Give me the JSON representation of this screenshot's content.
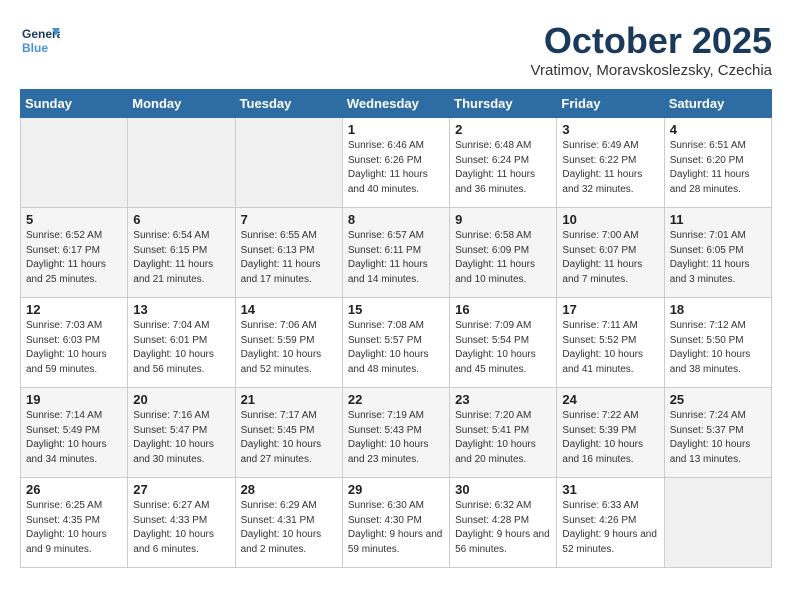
{
  "header": {
    "logo_line1": "General",
    "logo_line2": "Blue",
    "month": "October 2025",
    "location": "Vratimov, Moravskoslezsky, Czechia"
  },
  "weekdays": [
    "Sunday",
    "Monday",
    "Tuesday",
    "Wednesday",
    "Thursday",
    "Friday",
    "Saturday"
  ],
  "weeks": [
    [
      {
        "day": "",
        "info": ""
      },
      {
        "day": "",
        "info": ""
      },
      {
        "day": "",
        "info": ""
      },
      {
        "day": "1",
        "info": "Sunrise: 6:46 AM\nSunset: 6:26 PM\nDaylight: 11 hours\nand 40 minutes."
      },
      {
        "day": "2",
        "info": "Sunrise: 6:48 AM\nSunset: 6:24 PM\nDaylight: 11 hours\nand 36 minutes."
      },
      {
        "day": "3",
        "info": "Sunrise: 6:49 AM\nSunset: 6:22 PM\nDaylight: 11 hours\nand 32 minutes."
      },
      {
        "day": "4",
        "info": "Sunrise: 6:51 AM\nSunset: 6:20 PM\nDaylight: 11 hours\nand 28 minutes."
      }
    ],
    [
      {
        "day": "5",
        "info": "Sunrise: 6:52 AM\nSunset: 6:17 PM\nDaylight: 11 hours\nand 25 minutes."
      },
      {
        "day": "6",
        "info": "Sunrise: 6:54 AM\nSunset: 6:15 PM\nDaylight: 11 hours\nand 21 minutes."
      },
      {
        "day": "7",
        "info": "Sunrise: 6:55 AM\nSunset: 6:13 PM\nDaylight: 11 hours\nand 17 minutes."
      },
      {
        "day": "8",
        "info": "Sunrise: 6:57 AM\nSunset: 6:11 PM\nDaylight: 11 hours\nand 14 minutes."
      },
      {
        "day": "9",
        "info": "Sunrise: 6:58 AM\nSunset: 6:09 PM\nDaylight: 11 hours\nand 10 minutes."
      },
      {
        "day": "10",
        "info": "Sunrise: 7:00 AM\nSunset: 6:07 PM\nDaylight: 11 hours\nand 7 minutes."
      },
      {
        "day": "11",
        "info": "Sunrise: 7:01 AM\nSunset: 6:05 PM\nDaylight: 11 hours\nand 3 minutes."
      }
    ],
    [
      {
        "day": "12",
        "info": "Sunrise: 7:03 AM\nSunset: 6:03 PM\nDaylight: 10 hours\nand 59 minutes."
      },
      {
        "day": "13",
        "info": "Sunrise: 7:04 AM\nSunset: 6:01 PM\nDaylight: 10 hours\nand 56 minutes."
      },
      {
        "day": "14",
        "info": "Sunrise: 7:06 AM\nSunset: 5:59 PM\nDaylight: 10 hours\nand 52 minutes."
      },
      {
        "day": "15",
        "info": "Sunrise: 7:08 AM\nSunset: 5:57 PM\nDaylight: 10 hours\nand 48 minutes."
      },
      {
        "day": "16",
        "info": "Sunrise: 7:09 AM\nSunset: 5:54 PM\nDaylight: 10 hours\nand 45 minutes."
      },
      {
        "day": "17",
        "info": "Sunrise: 7:11 AM\nSunset: 5:52 PM\nDaylight: 10 hours\nand 41 minutes."
      },
      {
        "day": "18",
        "info": "Sunrise: 7:12 AM\nSunset: 5:50 PM\nDaylight: 10 hours\nand 38 minutes."
      }
    ],
    [
      {
        "day": "19",
        "info": "Sunrise: 7:14 AM\nSunset: 5:49 PM\nDaylight: 10 hours\nand 34 minutes."
      },
      {
        "day": "20",
        "info": "Sunrise: 7:16 AM\nSunset: 5:47 PM\nDaylight: 10 hours\nand 30 minutes."
      },
      {
        "day": "21",
        "info": "Sunrise: 7:17 AM\nSunset: 5:45 PM\nDaylight: 10 hours\nand 27 minutes."
      },
      {
        "day": "22",
        "info": "Sunrise: 7:19 AM\nSunset: 5:43 PM\nDaylight: 10 hours\nand 23 minutes."
      },
      {
        "day": "23",
        "info": "Sunrise: 7:20 AM\nSunset: 5:41 PM\nDaylight: 10 hours\nand 20 minutes."
      },
      {
        "day": "24",
        "info": "Sunrise: 7:22 AM\nSunset: 5:39 PM\nDaylight: 10 hours\nand 16 minutes."
      },
      {
        "day": "25",
        "info": "Sunrise: 7:24 AM\nSunset: 5:37 PM\nDaylight: 10 hours\nand 13 minutes."
      }
    ],
    [
      {
        "day": "26",
        "info": "Sunrise: 6:25 AM\nSunset: 4:35 PM\nDaylight: 10 hours\nand 9 minutes."
      },
      {
        "day": "27",
        "info": "Sunrise: 6:27 AM\nSunset: 4:33 PM\nDaylight: 10 hours\nand 6 minutes."
      },
      {
        "day": "28",
        "info": "Sunrise: 6:29 AM\nSunset: 4:31 PM\nDaylight: 10 hours\nand 2 minutes."
      },
      {
        "day": "29",
        "info": "Sunrise: 6:30 AM\nSunset: 4:30 PM\nDaylight: 9 hours\nand 59 minutes."
      },
      {
        "day": "30",
        "info": "Sunrise: 6:32 AM\nSunset: 4:28 PM\nDaylight: 9 hours\nand 56 minutes."
      },
      {
        "day": "31",
        "info": "Sunrise: 6:33 AM\nSunset: 4:26 PM\nDaylight: 9 hours\nand 52 minutes."
      },
      {
        "day": "",
        "info": ""
      }
    ]
  ]
}
